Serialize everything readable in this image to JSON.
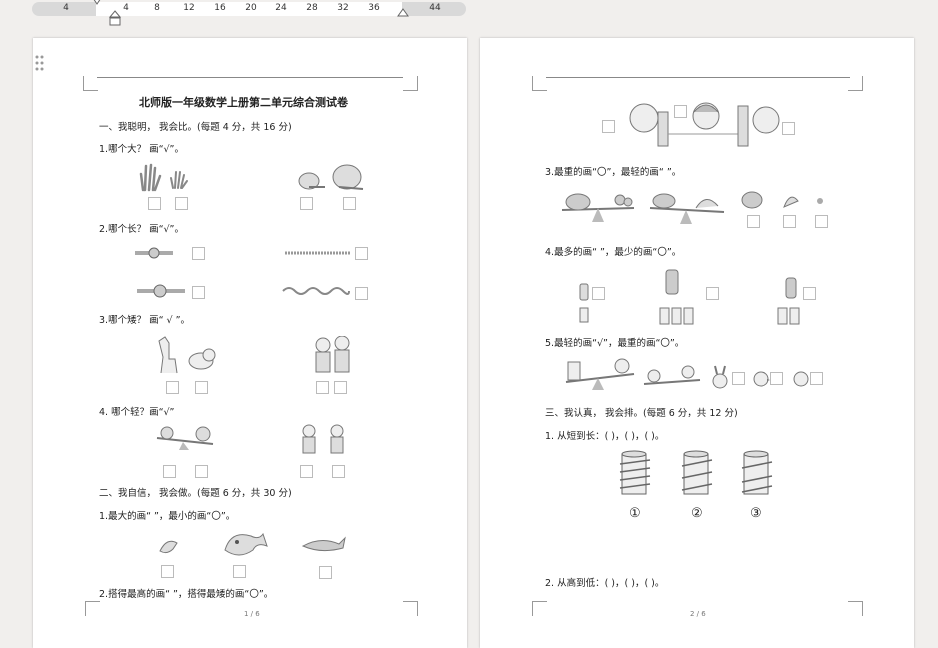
{
  "ruler": {
    "ticks": [
      "4",
      "4",
      "8",
      "12",
      "16",
      "20",
      "24",
      "28",
      "32",
      "36",
      "44"
    ]
  },
  "page1": {
    "title": "北师版一年级数学上册第二单元综合测试卷",
    "sec1": "一、我聪明， 我会比。(每题 4 分，共 16 分)",
    "q1": "1.哪个大？ 画“√”。",
    "q2": "2.哪个长？ 画“√”。",
    "q3": "3.哪个矮？ 画“ √ ”。",
    "q4": "4. 哪个轻？画“√”",
    "sec2": "二、我自信， 我会做。(每题 6 分，共 30 分)",
    "q21": "1.最大的画“ ”，最小的画“〇”。",
    "q22": "2.搭得最高的画“ ”，搭得最矮的画“〇”。",
    "page_num": "1 / 6"
  },
  "page2": {
    "q3": "3.最重的画“〇”，最轻的画“ ”。",
    "q4": "4.最多的画“ ”，最少的画“〇”。",
    "q5": "5.最轻的画“√”，最重的画“〇”。",
    "sec3": "三、我认真， 我会排。(每题 6 分，共 12 分)",
    "q31": "1. 从短到长：(        )，(        )，(        )。",
    "labels": [
      "①",
      "②",
      "③"
    ],
    "q32": "2. 从高到低：(        )，(        )，(        )。",
    "page_num": "2 / 6"
  }
}
